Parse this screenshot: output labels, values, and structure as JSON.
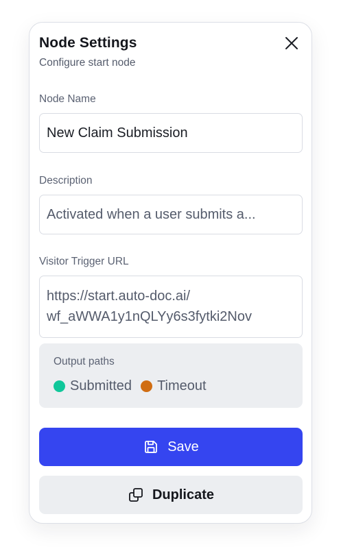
{
  "header": {
    "title": "Node Settings",
    "subtitle": "Configure start node"
  },
  "fields": {
    "node_name": {
      "label": "Node Name",
      "value": "New Claim Submission"
    },
    "description": {
      "label": "Description",
      "value": "Activated when a user submits a..."
    },
    "trigger_url": {
      "label": "Visitor Trigger URL",
      "line1": "https://start.auto-doc.ai/",
      "line2": "wf_aWWA1y1nQLYy6s3fytki2Nov"
    }
  },
  "output_paths": {
    "label": "Output paths",
    "items": [
      {
        "label": "Submitted",
        "color": "#10c79a"
      },
      {
        "label": "Timeout",
        "color": "#d06d12"
      }
    ]
  },
  "actions": {
    "save_label": "Save",
    "duplicate_label": "Duplicate"
  },
  "colors": {
    "primary": "#3545f0",
    "muted_bg": "#eceef1"
  },
  "icons": {
    "close": "close-icon",
    "save": "floppy-disk-icon",
    "duplicate": "copy-icon"
  }
}
